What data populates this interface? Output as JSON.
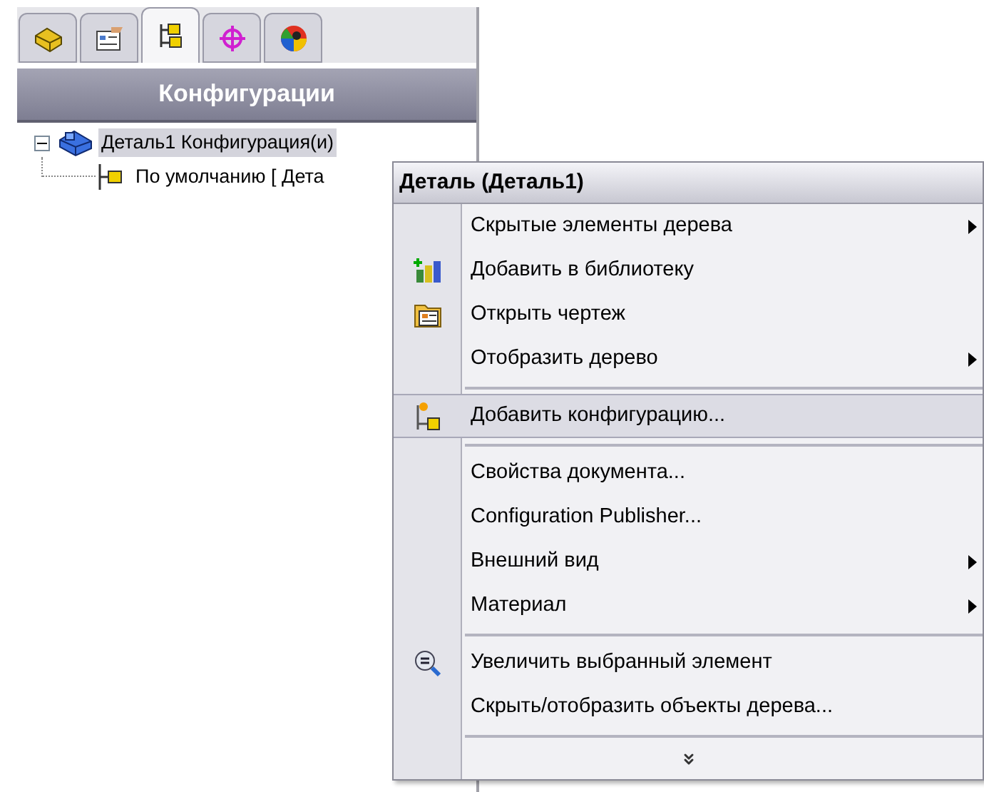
{
  "panel": {
    "tabs": [
      {
        "selected": false
      },
      {
        "selected": false
      },
      {
        "selected": true
      },
      {
        "selected": false
      },
      {
        "selected": false
      }
    ],
    "title": "Конфигурации",
    "tree": {
      "label": "Деталь1 Конфигурация(и)",
      "expanded": true,
      "selected": true,
      "children": [
        {
          "label": "По умолчанию [ Дета"
        }
      ]
    }
  },
  "context_menu": {
    "title": "Деталь (Деталь1)",
    "items": [
      {
        "kind": "item",
        "label": "Скрытые элементы дерева",
        "submenu": true,
        "selected": false
      },
      {
        "kind": "item",
        "label": "Добавить в библиотеку",
        "submenu": false,
        "selected": false
      },
      {
        "kind": "item",
        "label": "Открыть чертеж",
        "submenu": false,
        "selected": false
      },
      {
        "kind": "item",
        "label": "Отобразить дерево",
        "submenu": true,
        "selected": false
      },
      {
        "kind": "separator"
      },
      {
        "kind": "item",
        "label": "Добавить конфигурацию...",
        "submenu": false,
        "selected": true
      },
      {
        "kind": "separator"
      },
      {
        "kind": "item",
        "label": "Свойства документа...",
        "submenu": false,
        "selected": false
      },
      {
        "kind": "item",
        "label": "Configuration Publisher...",
        "submenu": false,
        "selected": false
      },
      {
        "kind": "item",
        "label": "Внешний вид",
        "submenu": true,
        "selected": false
      },
      {
        "kind": "item",
        "label": "Материал",
        "submenu": true,
        "selected": false
      },
      {
        "kind": "separator"
      },
      {
        "kind": "item",
        "label": "Увеличить выбранный элемент",
        "submenu": false,
        "selected": false
      },
      {
        "kind": "item",
        "label": "Скрыть/отобразить объекты дерева...",
        "submenu": false,
        "selected": false
      },
      {
        "kind": "separator"
      },
      {
        "kind": "more"
      }
    ]
  }
}
